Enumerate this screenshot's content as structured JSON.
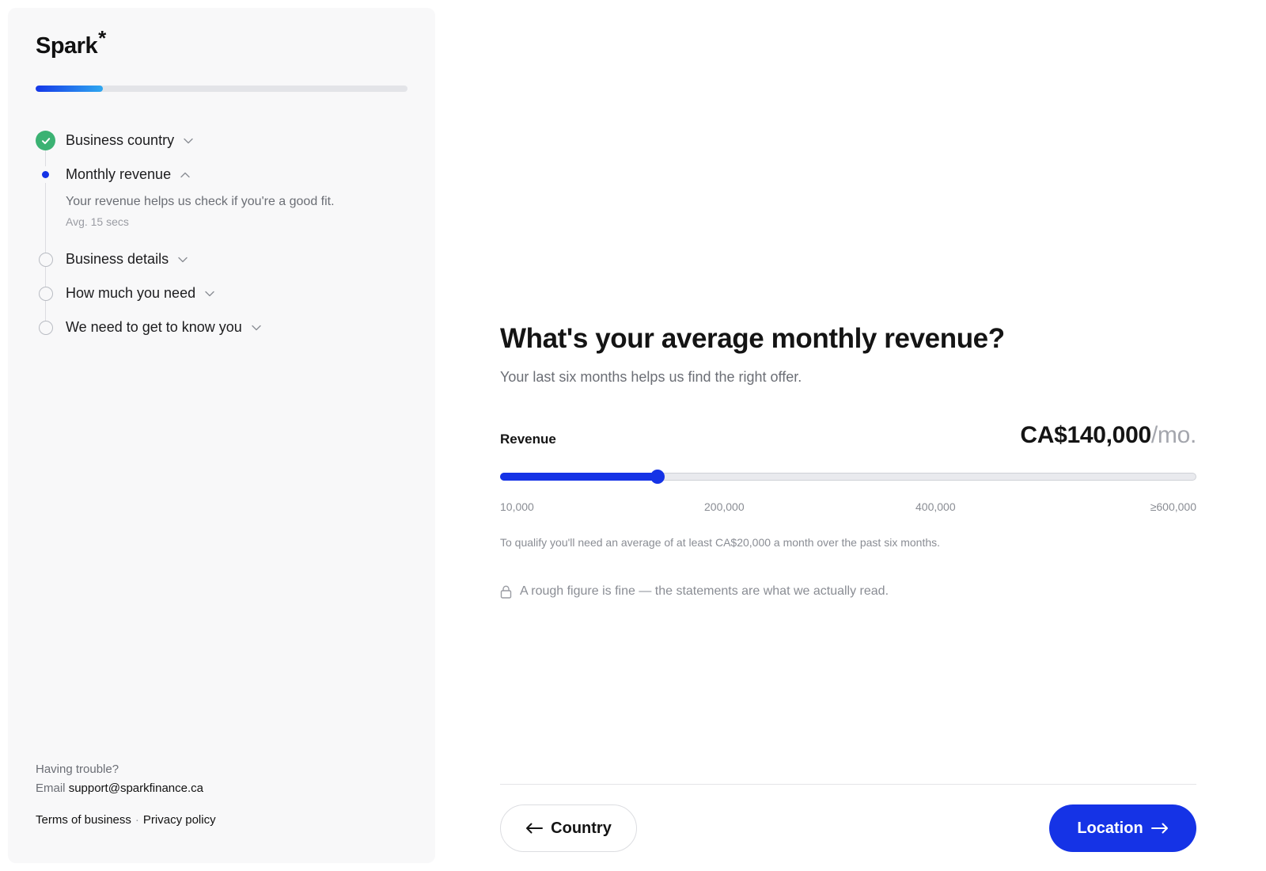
{
  "brand": {
    "name": "Spark",
    "mark": "*"
  },
  "colors": {
    "accent": "#1533e6",
    "success": "#3bb273",
    "progress_gradient_end": "#2fa8f0"
  },
  "progress": {
    "fraction": 0.18
  },
  "steps": [
    {
      "label": "Business country",
      "status": "done",
      "icon": "chevron-down-icon"
    },
    {
      "label": "Monthly revenue",
      "status": "current",
      "icon": "chevron-up-icon",
      "description": "Your revenue helps us check if you're a good fit.",
      "time": "Avg. 15 secs"
    },
    {
      "label": "Business details",
      "status": "pending",
      "icon": "chevron-down-icon"
    },
    {
      "label": "How much you need",
      "status": "pending",
      "icon": "chevron-down-icon"
    },
    {
      "label": "We need to get to know you",
      "status": "pending",
      "icon": "chevron-down-icon"
    }
  ],
  "help": {
    "question": "Having trouble?",
    "email_prefix": "Email",
    "email": "support@sparkfinance.ca"
  },
  "legal": {
    "terms": "Terms of business",
    "separator": "·",
    "privacy": "Privacy policy"
  },
  "main": {
    "question": "What's your average monthly revenue?",
    "subtitle": "Your last six months helps us find the right offer.",
    "revenue_label": "Revenue",
    "revenue_value": "CA$140,000",
    "revenue_unit": "/mo.",
    "slider": {
      "min": 10000,
      "max": 600000,
      "value": 140000,
      "fill_fraction": 0.226,
      "ticks": [
        "10,000",
        "200,000",
        "400,000",
        "≥600,000"
      ]
    },
    "qualify_note": "To qualify you'll need an average of at least CA$20,000 a month over the past six months.",
    "privacy_note": "A rough figure is fine — the statements are what we actually read.",
    "privacy_icon": "lock-icon"
  },
  "nav": {
    "back_label": "Country",
    "back_icon": "arrow-left-icon",
    "next_label": "Location",
    "next_icon": "arrow-right-icon"
  }
}
